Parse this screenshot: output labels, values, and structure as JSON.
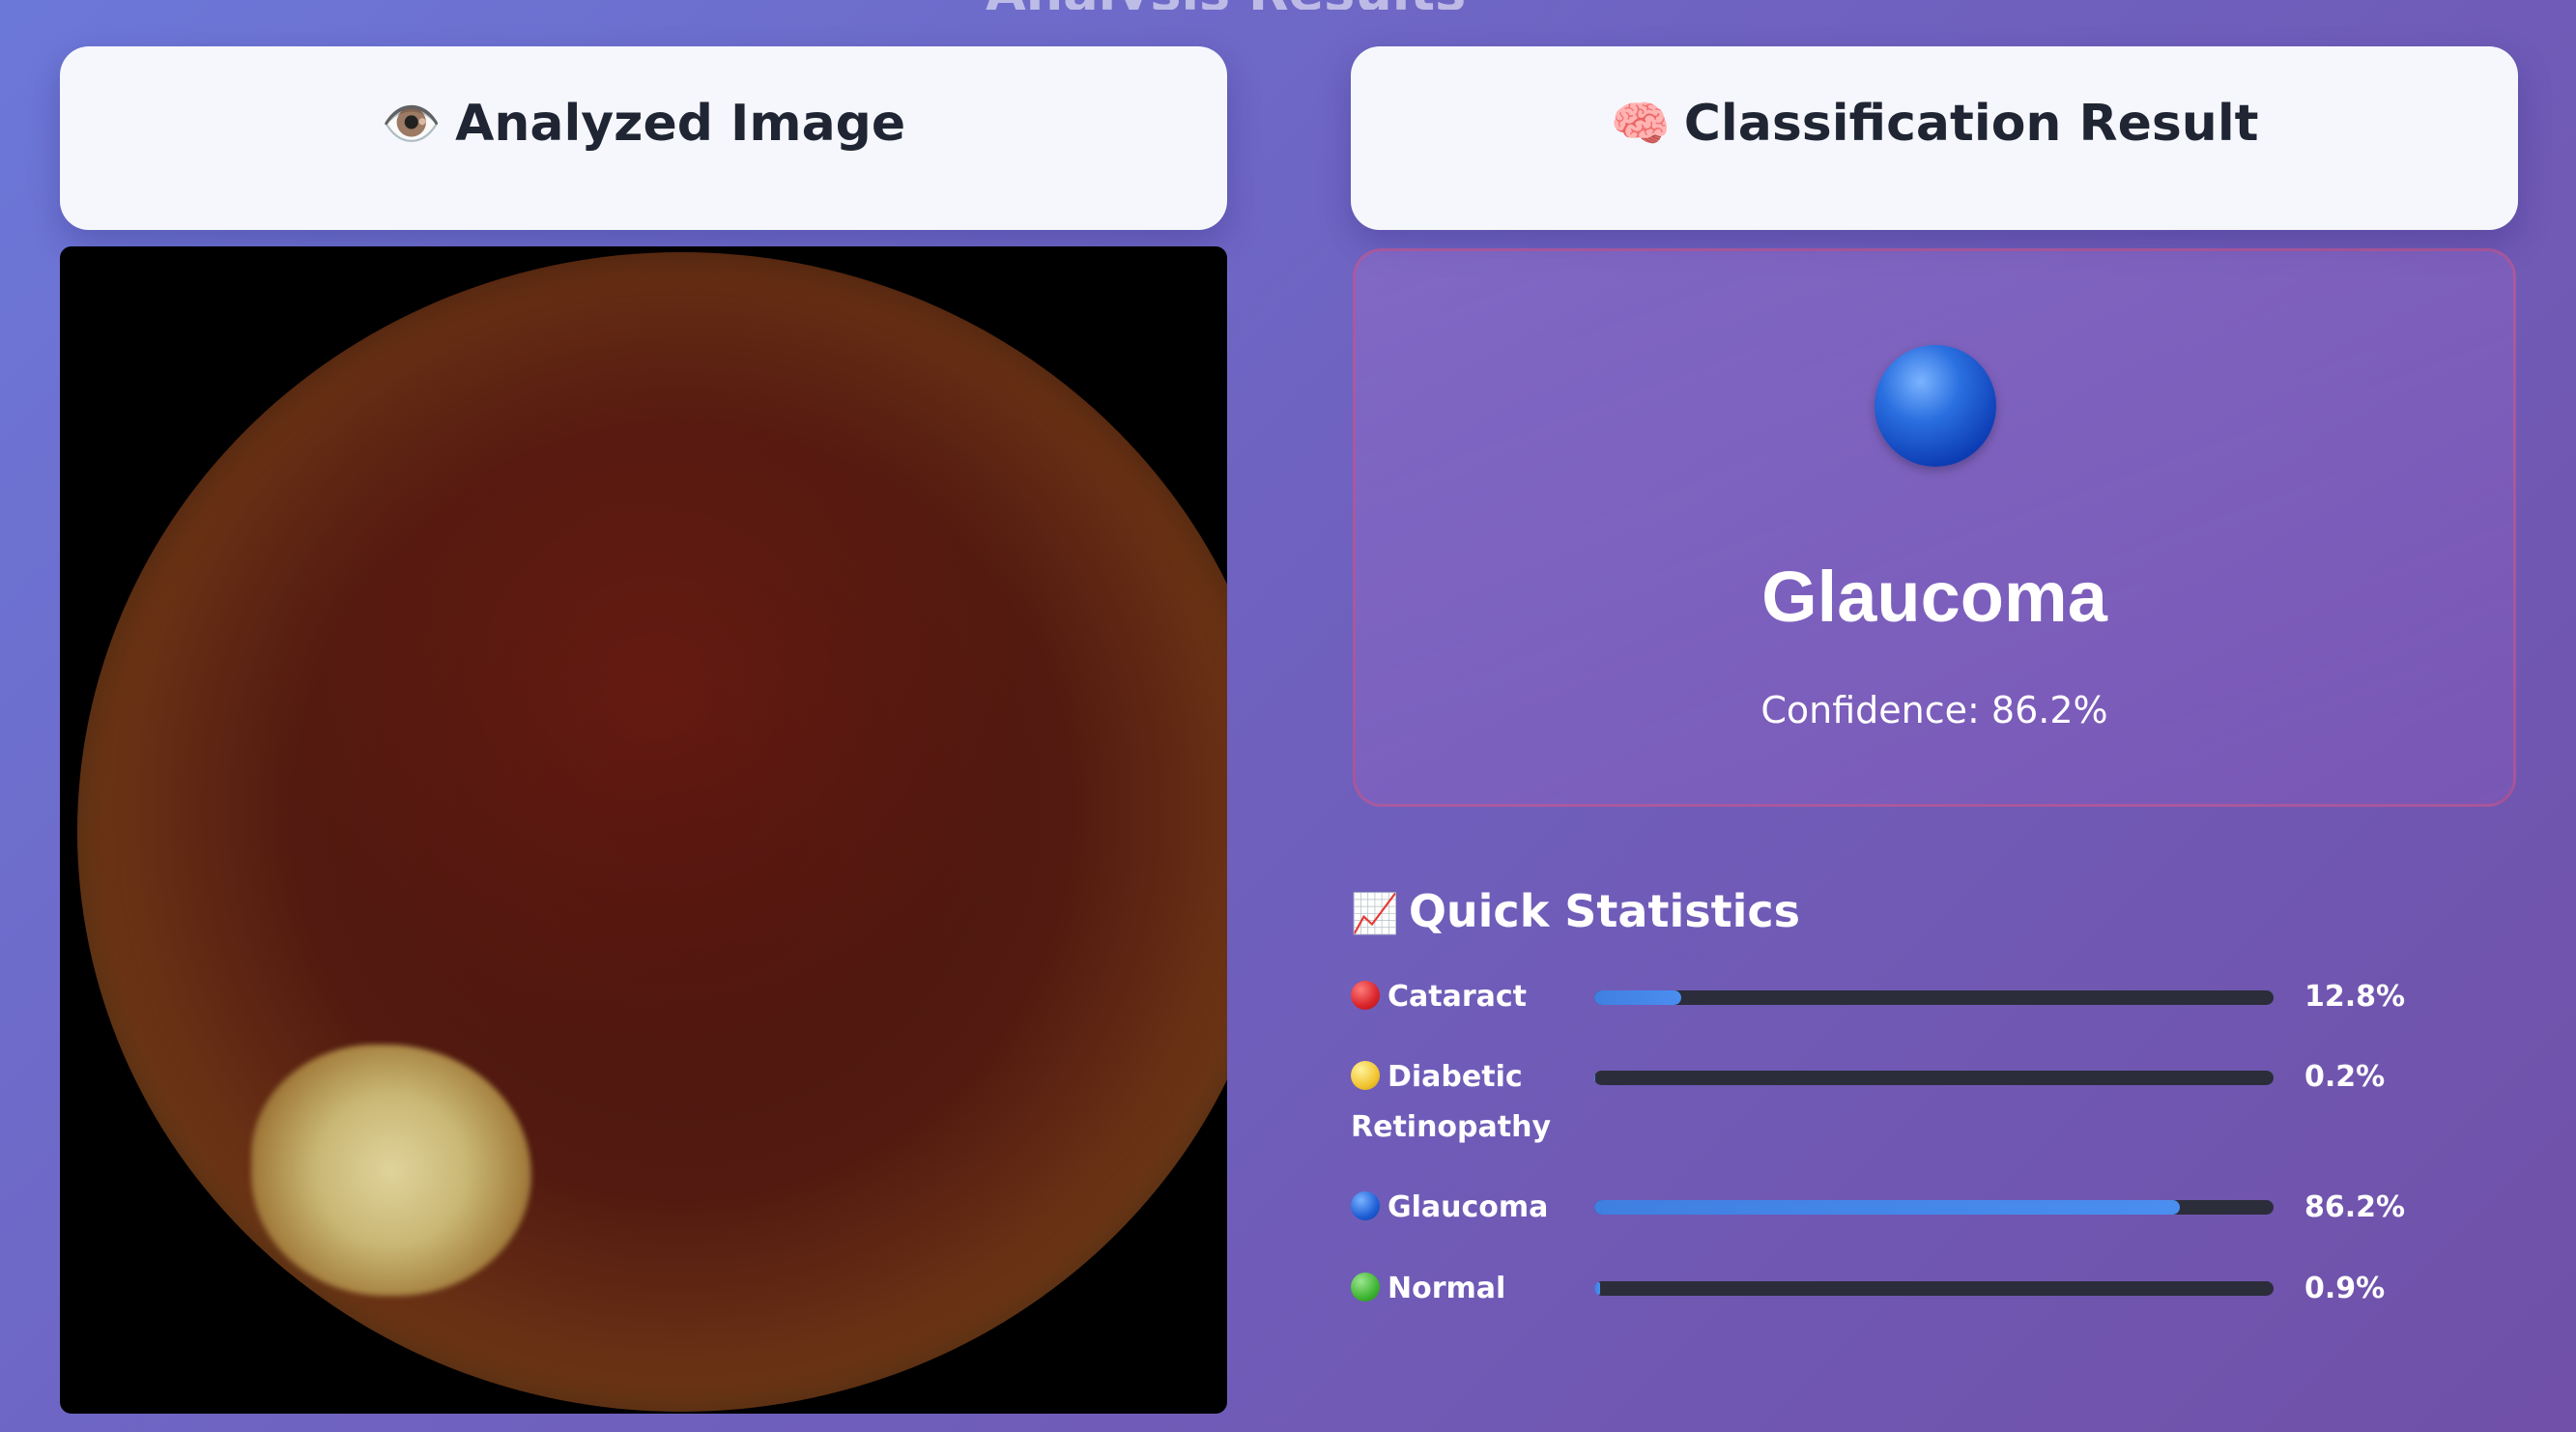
{
  "page": {
    "section_title": "Analysis Results"
  },
  "left_card": {
    "icon": "eye-icon",
    "title": "Analyzed Image"
  },
  "right_card": {
    "icon": "brain-icon",
    "title": "Classification Result"
  },
  "result": {
    "icon": "blue-circle-icon",
    "label": "Glaucoma",
    "confidence_text": "Confidence: 86.2%",
    "confidence": 0.862
  },
  "stats": {
    "icon": "chart-increasing-icon",
    "title": "Quick Statistics",
    "items": [
      {
        "label": "Cataract",
        "value_text": "12.8%",
        "fraction": 0.128,
        "color": "#d9242a",
        "icon": "red-circle-icon"
      },
      {
        "label": "Diabetic Retinopathy",
        "value_text": "0.2%",
        "fraction": 0.002,
        "color": "#f2c531",
        "icon": "yellow-circle-icon"
      },
      {
        "label": "Glaucoma",
        "value_text": "86.2%",
        "fraction": 0.862,
        "color": "#1f5fd6",
        "icon": "blue-circle-icon"
      },
      {
        "label": "Normal",
        "value_text": "0.9%",
        "fraction": 0.009,
        "color": "#3fb532",
        "icon": "green-circle-icon"
      }
    ]
  },
  "colors": {
    "bar_fill": "#4a8ef0",
    "bar_track": "#2b2d3a",
    "card_bg": "#f6f7fc"
  }
}
